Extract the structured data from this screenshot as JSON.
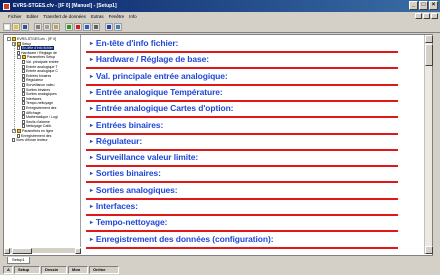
{
  "window": {
    "title": "EVRS-STGES.cfv - [IF 0] [Manuel] - [Setup1]",
    "buttons": {
      "minimize": "_",
      "maximize": "□",
      "close": "×"
    }
  },
  "menubar": {
    "items": [
      "Fichier",
      "Editer",
      "Transfert de données",
      "Extras",
      "Fenêtre",
      "Info"
    ]
  },
  "toolbar": {
    "buttons": [
      {
        "name": "new",
        "color": "#ffffff"
      },
      {
        "name": "open",
        "color": "#e8c040"
      },
      {
        "name": "save",
        "color": "#3050a0"
      },
      {
        "name": "sep"
      },
      {
        "name": "cut",
        "color": "#808080"
      },
      {
        "name": "copy",
        "color": "#a0a0a0"
      },
      {
        "name": "paste",
        "color": "#c0a060"
      },
      {
        "name": "sep"
      },
      {
        "name": "transfer-to",
        "color": "#20a020"
      },
      {
        "name": "transfer-from",
        "color": "#d02020"
      },
      {
        "name": "online",
        "color": "#2060d0"
      },
      {
        "name": "print",
        "color": "#606060"
      },
      {
        "name": "sep"
      },
      {
        "name": "help",
        "color": "#2040c0"
      },
      {
        "name": "window",
        "color": "#4080c0"
      }
    ]
  },
  "tree": {
    "nodes": [
      {
        "label": "EVRS-STGES.cfv - [IF 0]",
        "level": 0,
        "kind": "root"
      },
      {
        "label": "Setup",
        "level": 1,
        "kind": "folder"
      },
      {
        "label": "En-tête d'info fichier",
        "level": 2,
        "kind": "page",
        "selected": true
      },
      {
        "label": "Hardware / Réglage de",
        "level": 2,
        "kind": "page"
      },
      {
        "label": "Paramètres Setup",
        "level": 2,
        "kind": "folder"
      },
      {
        "label": "Val. principale entrée",
        "level": 3,
        "kind": "page"
      },
      {
        "label": "Entrée analogique T",
        "level": 3,
        "kind": "page"
      },
      {
        "label": "Entrée analogique C",
        "level": 3,
        "kind": "page"
      },
      {
        "label": "Entrées binaires",
        "level": 3,
        "kind": "page"
      },
      {
        "label": "Régulateur",
        "level": 3,
        "kind": "page"
      },
      {
        "label": "Surveillance valeu",
        "level": 3,
        "kind": "page"
      },
      {
        "label": "Sorties binaires",
        "level": 3,
        "kind": "page"
      },
      {
        "label": "Sorties analogiques",
        "level": 3,
        "kind": "page"
      },
      {
        "label": "Interfaces",
        "level": 3,
        "kind": "page"
      },
      {
        "label": "Tempo-nettoyage",
        "level": 3,
        "kind": "page"
      },
      {
        "label": "Enregistrement des",
        "level": 3,
        "kind": "page"
      },
      {
        "label": "Affichage",
        "level": 3,
        "kind": "page"
      },
      {
        "label": "Mathématique / Logi",
        "level": 3,
        "kind": "page"
      },
      {
        "label": "Seuils d'alarme",
        "level": 3,
        "kind": "page"
      },
      {
        "label": "Nettoyage Calib.",
        "level": 3,
        "kind": "page"
      },
      {
        "label": "Paramètres en ligne",
        "level": 1,
        "kind": "folder"
      },
      {
        "label": "Enregistrement des",
        "level": 2,
        "kind": "page"
      },
      {
        "label": "Vues d'écran lecteur",
        "level": 1,
        "kind": "page"
      }
    ]
  },
  "sections": [
    {
      "label": "En-tête d'info fichier:"
    },
    {
      "label": "Hardware / Réglage de base:"
    },
    {
      "label": "Val. principale entrée analogique:"
    },
    {
      "label": "Entrée analogique Température:"
    },
    {
      "label": "Entrée analogique Cartes d'option:"
    },
    {
      "label": "Entrées binaires:"
    },
    {
      "label": "Régulateur:"
    },
    {
      "label": "Surveillance valeur limite:"
    },
    {
      "label": "Sorties binaires:"
    },
    {
      "label": "Sorties analogiques:"
    },
    {
      "label": "Interfaces:"
    },
    {
      "label": "Tempo-nettoyage:"
    },
    {
      "label": "Enregistrement des données (configuration):"
    }
  ],
  "section_chevron": "▸",
  "doc_tab": "Setup1",
  "status": {
    "cells": [
      "A",
      "Setup",
      "Dessin",
      "Mon",
      "Online"
    ]
  },
  "colors": {
    "section_text": "#2048d8",
    "section_rule": "#e01818",
    "titlebar": "#0a246a"
  }
}
